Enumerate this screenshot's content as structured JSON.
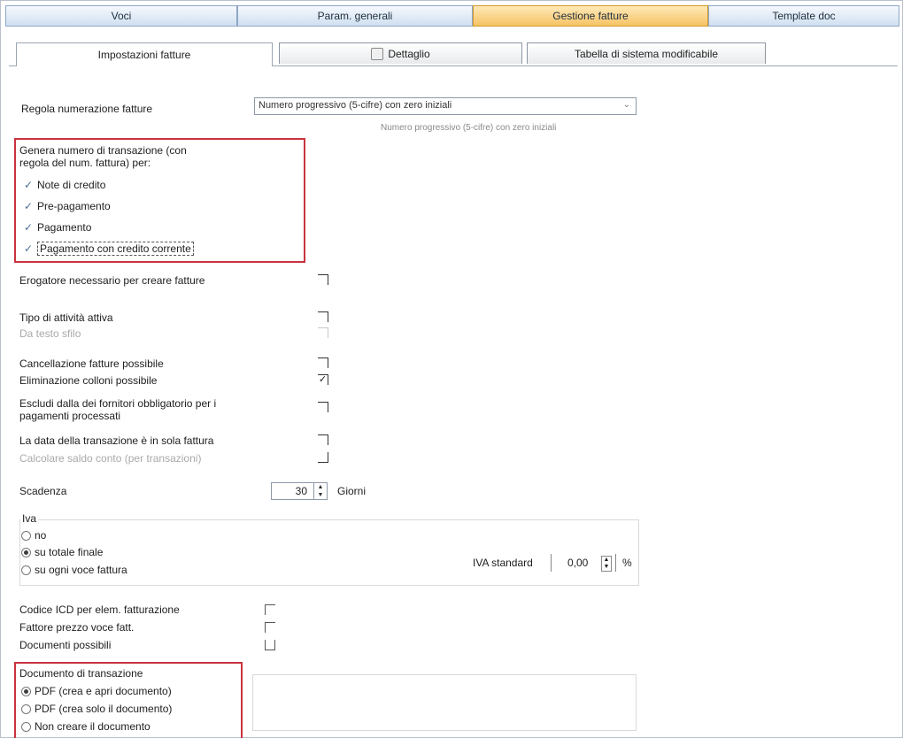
{
  "top_tabs": [
    "Voci",
    "Param. generali",
    "Gestione fatture",
    "Template doc"
  ],
  "sub_tabs": [
    "Impostazioni fatture",
    "Dettaglio",
    "Tabella di sistema modificabile"
  ],
  "numbering": {
    "label": "Regola numerazione fatture",
    "value": "Numero progressivo (5-cifre) con zero iniziali",
    "hint": "Numero progressivo (5-cifre) con zero iniziali"
  },
  "transaction_group": {
    "title_line1": "Genera numero di transazione (con",
    "title_line2": "regola del num. fattura) per:",
    "items": [
      {
        "label": "Note di credito",
        "checked": true
      },
      {
        "label": "Pre-pagamento",
        "checked": true
      },
      {
        "label": "Pagamento",
        "checked": true
      },
      {
        "label": "Pagamento con credito corrente",
        "checked": true
      }
    ]
  },
  "options": [
    {
      "label": "Erogatore necessario per creare fatture",
      "state": "unchecked",
      "disabled": false
    },
    {
      "label": "Tipo di attività attiva",
      "state": "unchecked",
      "disabled": false
    },
    {
      "label": "Da testo sfilo",
      "state": "unchecked",
      "disabled": true
    },
    {
      "label": "Cancellazione fatture possibile",
      "state": "unchecked",
      "disabled": false
    },
    {
      "label": "Eliminazione colloni possibile",
      "state": "checked",
      "disabled": false
    },
    {
      "label_line1": "Escludi dalla dei fornitori obbligatorio per i",
      "label_line2": "pagamenti processati",
      "state": "unchecked",
      "disabled": false
    },
    {
      "label": "La data della transazione è in sola fattura",
      "state": "unchecked",
      "disabled": false
    },
    {
      "label": "Calcolare saldo conto (per transazioni)",
      "state": "unchecked",
      "disabled": true
    }
  ],
  "due": {
    "label": "Scadenza",
    "value": "30",
    "unit": "Giorni"
  },
  "iva_group": {
    "title": "Iva",
    "radios": [
      {
        "label": "no",
        "selected": false
      },
      {
        "label": "su totale finale",
        "selected": true
      },
      {
        "label": "su ogni voce fattura",
        "selected": false
      }
    ],
    "standard_label": "IVA standard",
    "standard_value": "0,00",
    "standard_unit": "%"
  },
  "bottom_checks": [
    {
      "label": "Codice ICD per elem. fatturazione",
      "checked": false
    },
    {
      "label": "Fattore prezzo voce fatt.",
      "checked": false
    },
    {
      "label": "Documenti possibili",
      "checked": false
    }
  ],
  "document_group": {
    "title": "Documento di transazione",
    "radios": [
      {
        "label": "PDF (crea e apri documento)",
        "selected": true
      },
      {
        "label": "PDF (crea solo il documento)",
        "selected": false
      },
      {
        "label": "Non creare il documento",
        "selected": false
      }
    ]
  },
  "colors": {
    "active_tab": "#f6c364",
    "highlight": "#c8333f",
    "tab_border": "#8ea7c6"
  }
}
